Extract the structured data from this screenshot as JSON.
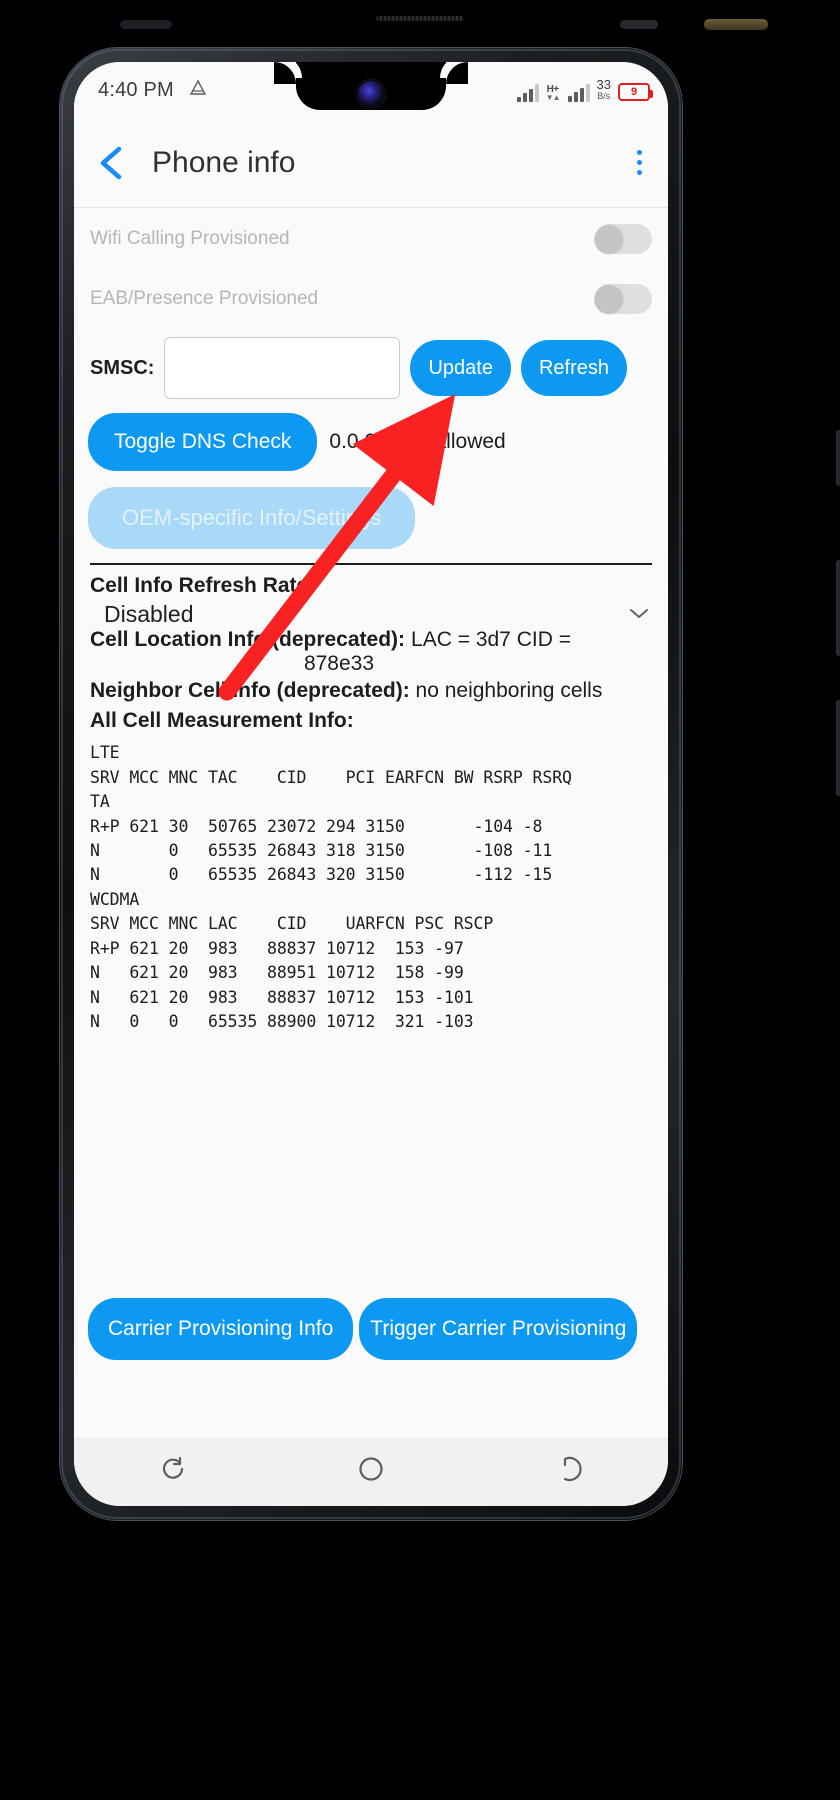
{
  "status_bar": {
    "time": "4:40 PM",
    "left_icon": "triangle-nav-icon",
    "signal_icon_1": "signal-bars-icon",
    "network_type": "H+",
    "data_arrows": "▼▲",
    "signal_icon_2": "signal-bars-icon",
    "net_speed_value": "33",
    "net_speed_unit": "B/s",
    "battery_level": "9",
    "battery_color": "#e02020"
  },
  "app_bar": {
    "back_icon": "back-chevron-icon",
    "title": "Phone info",
    "overflow_icon": "kebab-menu-icon",
    "accent_color": "#1b8cf5"
  },
  "provisioning": [
    {
      "label": "Wifi Calling Provisioned",
      "state": "off"
    },
    {
      "label": "EAB/Presence Provisioned",
      "state": "off"
    }
  ],
  "smsc": {
    "label": "SMSC:",
    "value": "",
    "placeholder": "",
    "update_label": "Update",
    "refresh_label": "Refresh"
  },
  "dns": {
    "toggle_label": "Toggle DNS Check",
    "status_text": "0.0.0.0 not allowed"
  },
  "oem": {
    "label": "OEM-specific Info/Settings",
    "disabled": true
  },
  "cell_info_refresh_rate": {
    "label": "Cell Info Refresh Rate:",
    "value": "Disabled",
    "chevron": "⌄"
  },
  "cell_location_info": {
    "label": "Cell Location Info (deprecated):",
    "value_line1": "LAC = 3d7   CID =",
    "value_line2": "878e33"
  },
  "neighbor_cell_info": {
    "label": "Neighbor Cell Info (deprecated):",
    "value": "no neighboring cells"
  },
  "all_cell_measurement_info": {
    "label": "All Cell Measurement Info:",
    "text": "LTE\nSRV MCC MNC TAC    CID    PCI EARFCN BW RSRP RSRQ\nTA\nR+P 621 30  50765 23072 294 3150       -104 -8\nN       0   65535 26843 318 3150       -108 -11\nN       0   65535 26843 320 3150       -112 -15\nWCDMA\nSRV MCC MNC LAC    CID    UARFCN PSC RSCP\nR+P 621 20  983   88837 10712  153 -97\nN   621 20  983   88951 10712  158 -99\nN   621 20  983   88837 10712  153 -101\nN   0   0   65535 88900 10712  321 -103"
  },
  "bottom_actions": {
    "carrier_provisioning_info": "Carrier Provisioning Info",
    "trigger_carrier_provisioning": "Trigger Carrier Provisioning"
  },
  "nav_bar": {
    "recents_icon": "recents-icon",
    "home_icon": "home-circle-icon",
    "back_icon": "back-arrow-icon"
  },
  "annotation": {
    "arrow_color": "#f92222",
    "arrow_target": "update-button"
  },
  "theme": {
    "accent": "#0d99f2",
    "accent_disabled": "#a9d9f8",
    "screen_bg": "#fafafa",
    "text": "#1c1d1f",
    "muted_text": "#b4b6b8"
  }
}
